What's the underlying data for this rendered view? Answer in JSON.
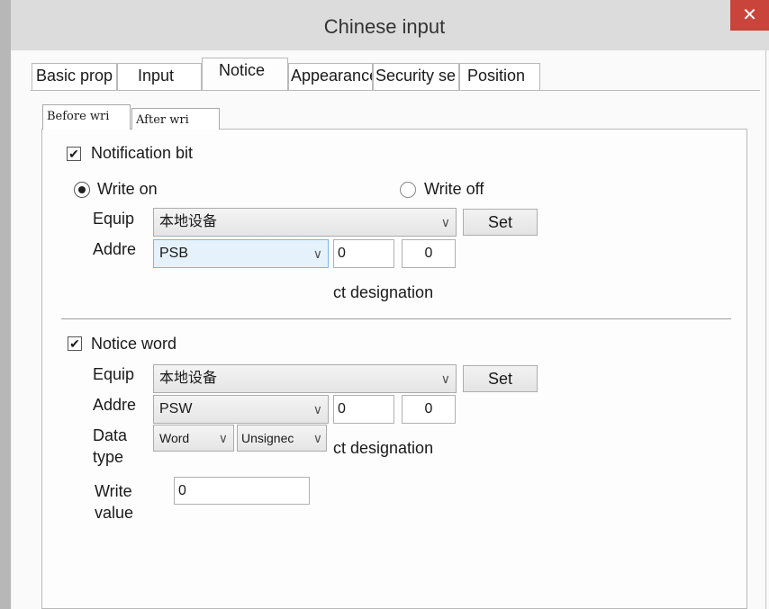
{
  "window": {
    "title": "Chinese input",
    "close_glyph": "✕"
  },
  "tabs": [
    {
      "label": "Basic prop",
      "active": false
    },
    {
      "label": "Input",
      "active": false
    },
    {
      "label": "Notice",
      "active": true
    },
    {
      "label": "Appearance",
      "active": false
    },
    {
      "label": "Security se",
      "active": false
    },
    {
      "label": "Position",
      "active": false
    }
  ],
  "subtabs": [
    {
      "label": "Before wri",
      "active": true
    },
    {
      "label": "After wri",
      "active": false
    }
  ],
  "notification_bit": {
    "checkbox_label": "Notification bit",
    "checked": true,
    "write_on_label": "Write on",
    "write_off_label": "Write off",
    "selected": "write_on",
    "equip_label": "Equip",
    "equip_value": "本地设备",
    "set_label": "Set",
    "addr_label": "Addre",
    "addr_type": "PSB",
    "addr_value1": "0",
    "addr_value2": "0",
    "designation": "ct designation"
  },
  "notice_word": {
    "checkbox_label": "Notice word",
    "checked": true,
    "equip_label": "Equip",
    "equip_value": "本地设备",
    "set_label": "Set",
    "addr_label": "Addre",
    "addr_type": "PSW",
    "addr_value1": "0",
    "addr_value2": "0",
    "datatype_label_1": "Data",
    "datatype_label_2": "type",
    "datatype_value": "Word",
    "datatype_sign": "Unsignec",
    "designation": "ct designation",
    "write_label_1": "Write",
    "write_label_2": "value",
    "write_value": "0"
  },
  "icons": {
    "checkmark": "✔",
    "dropdown": "∨"
  }
}
